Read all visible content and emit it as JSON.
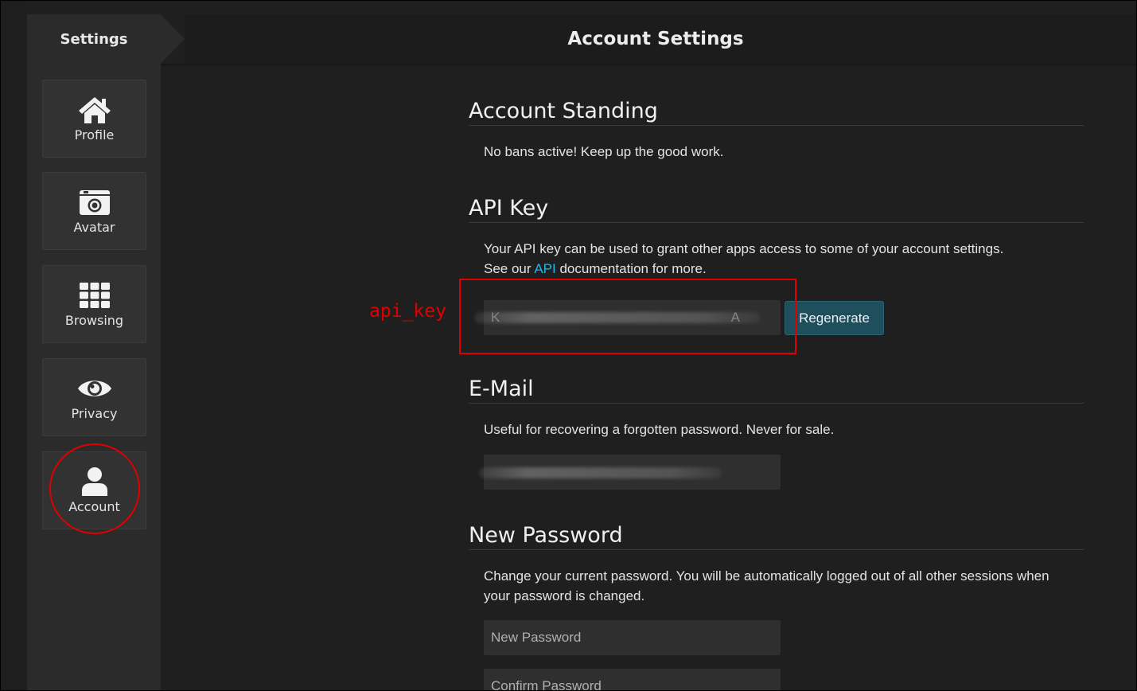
{
  "sidebar": {
    "header": "Settings",
    "items": [
      {
        "label": "Profile",
        "icon": "home-icon"
      },
      {
        "label": "Avatar",
        "icon": "camera-icon"
      },
      {
        "label": "Browsing",
        "icon": "grid-icon"
      },
      {
        "label": "Privacy",
        "icon": "eye-icon"
      },
      {
        "label": "Account",
        "icon": "user-icon"
      }
    ]
  },
  "header": {
    "title": "Account Settings"
  },
  "standing": {
    "title": "Account Standing",
    "text": "No bans active! Keep up the good work."
  },
  "api": {
    "title": "API Key",
    "line1": "Your API key can be used to grant other apps access to some of your account settings.",
    "line2_pre": "See our ",
    "line2_link": "API",
    "line2_post": " documentation for more.",
    "key_start": "K",
    "key_end": "A",
    "regenerate_label": "Regenerate"
  },
  "email": {
    "title": "E-Mail",
    "text": "Useful for recovering a forgotten password. Never for sale."
  },
  "password": {
    "title": "New Password",
    "text": "Change your current password. You will be automatically logged out of all other sessions when your password is changed.",
    "new_placeholder": "New Password",
    "confirm_placeholder": "Confirm Password"
  },
  "annotation": {
    "label": "api_key",
    "color": "#e00000"
  },
  "colors": {
    "link": "#23b7e5",
    "button": "#1f4e5c"
  }
}
